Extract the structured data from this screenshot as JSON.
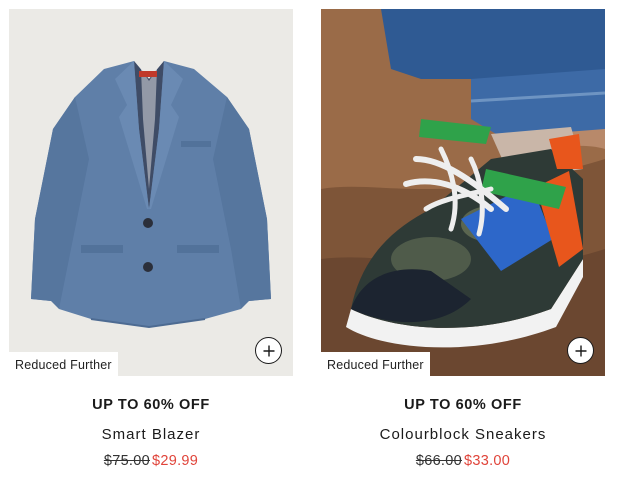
{
  "products": [
    {
      "badge": "Reduced Further",
      "promo": "UP TO 60% OFF",
      "name": "Smart Blazer",
      "was_price": "$75.00",
      "now_price": "$29.99",
      "image": "blazer-photo"
    },
    {
      "badge": "Reduced Further",
      "promo": "UP TO 60% OFF",
      "name": "Colourblock Sneakers",
      "was_price": "$66.00",
      "now_price": "$33.00",
      "image": "sneakers-photo"
    }
  ],
  "colors": {
    "sale_price": "#e0443a",
    "image_bg_left": "#ebeae6",
    "image_bg_right": "#9a6b48"
  },
  "icons": {
    "add": "plus-icon"
  }
}
